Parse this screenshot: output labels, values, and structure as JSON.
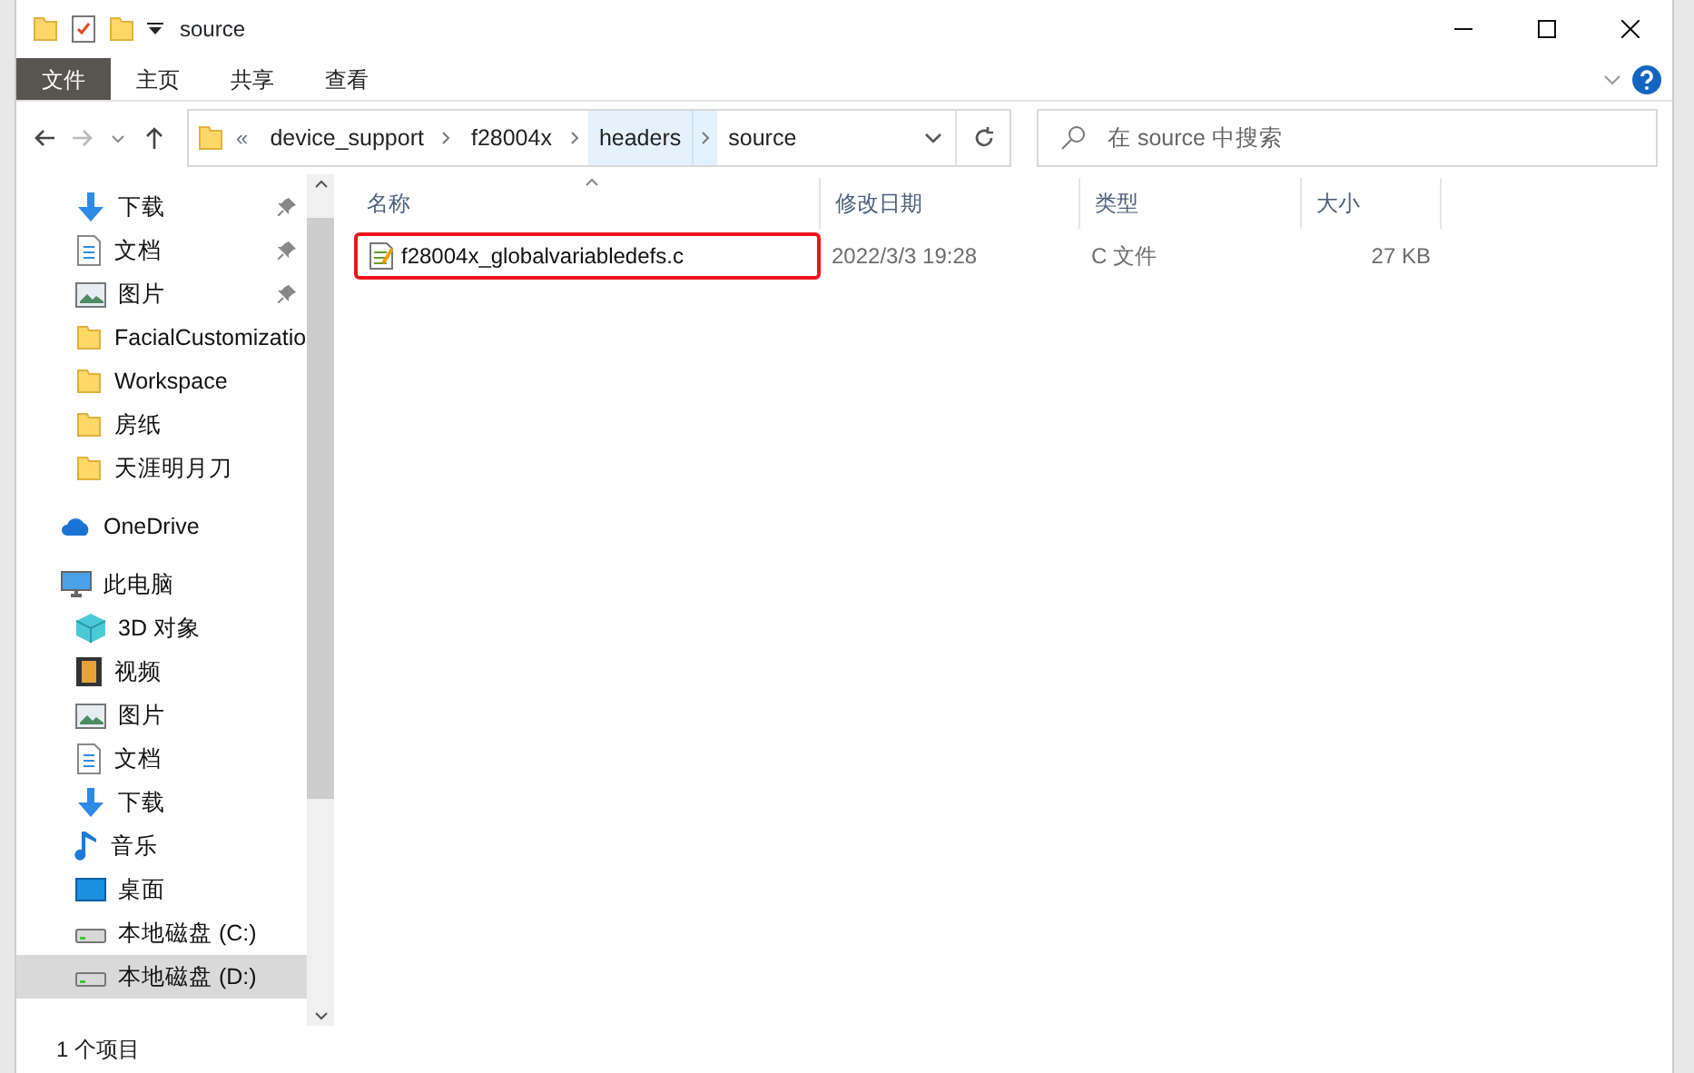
{
  "window": {
    "title": "source"
  },
  "ribbon_tabs": [
    {
      "label": "文件",
      "selected": true
    },
    {
      "label": "主页",
      "selected": false
    },
    {
      "label": "共享",
      "selected": false
    },
    {
      "label": "查看",
      "selected": false
    }
  ],
  "breadcrumb_overflow": "«",
  "breadcrumb": [
    {
      "label": "device_support",
      "selected": false
    },
    {
      "label": "f28004x",
      "selected": false
    },
    {
      "label": "headers",
      "selected": true
    },
    {
      "label": "source",
      "selected": false
    }
  ],
  "search": {
    "placeholder": "在 source 中搜索"
  },
  "sidebar": {
    "items": [
      {
        "label": "下载",
        "kind": "download",
        "pinned": true,
        "selected": false
      },
      {
        "label": "文档",
        "kind": "document",
        "pinned": true,
        "selected": false
      },
      {
        "label": "图片",
        "kind": "picture",
        "pinned": true,
        "selected": false
      },
      {
        "label": "FacialCustomizatio",
        "kind": "folder",
        "pinned": false,
        "selected": false
      },
      {
        "label": "Workspace",
        "kind": "folder",
        "pinned": false,
        "selected": false
      },
      {
        "label": "房纸",
        "kind": "folder",
        "pinned": false,
        "selected": false
      },
      {
        "label": "天涯明月刀",
        "kind": "folder",
        "pinned": false,
        "selected": false
      },
      {
        "label": "OneDrive",
        "kind": "cloud",
        "pinned": false,
        "selected": false
      },
      {
        "label": "此电脑",
        "kind": "pc",
        "pinned": false,
        "selected": false,
        "children": [
          {
            "label": "3D 对象",
            "kind": "cube",
            "pinned": false,
            "selected": false
          },
          {
            "label": "视频",
            "kind": "video",
            "pinned": false,
            "selected": false
          },
          {
            "label": "图片",
            "kind": "picture",
            "pinned": false,
            "selected": false
          },
          {
            "label": "文档",
            "kind": "document",
            "pinned": false,
            "selected": false
          },
          {
            "label": "下载",
            "kind": "download",
            "pinned": false,
            "selected": false
          },
          {
            "label": "音乐",
            "kind": "music",
            "pinned": false,
            "selected": false
          },
          {
            "label": "桌面",
            "kind": "desktop",
            "pinned": false,
            "selected": false
          },
          {
            "label": "本地磁盘 (C:)",
            "kind": "drive",
            "pinned": false,
            "selected": false
          },
          {
            "label": "本地磁盘 (D:)",
            "kind": "drive",
            "pinned": false,
            "selected": true
          }
        ]
      }
    ]
  },
  "table": {
    "columns": [
      "名称",
      "修改日期",
      "类型",
      "大小"
    ],
    "rows": [
      {
        "name": "f28004x_globalvariabledefs.c",
        "modified": "2022/3/3 19:28",
        "type": "C 文件",
        "size": "27 KB",
        "highlighted": true
      }
    ]
  },
  "status_bar": {
    "count": "1 个项目"
  }
}
